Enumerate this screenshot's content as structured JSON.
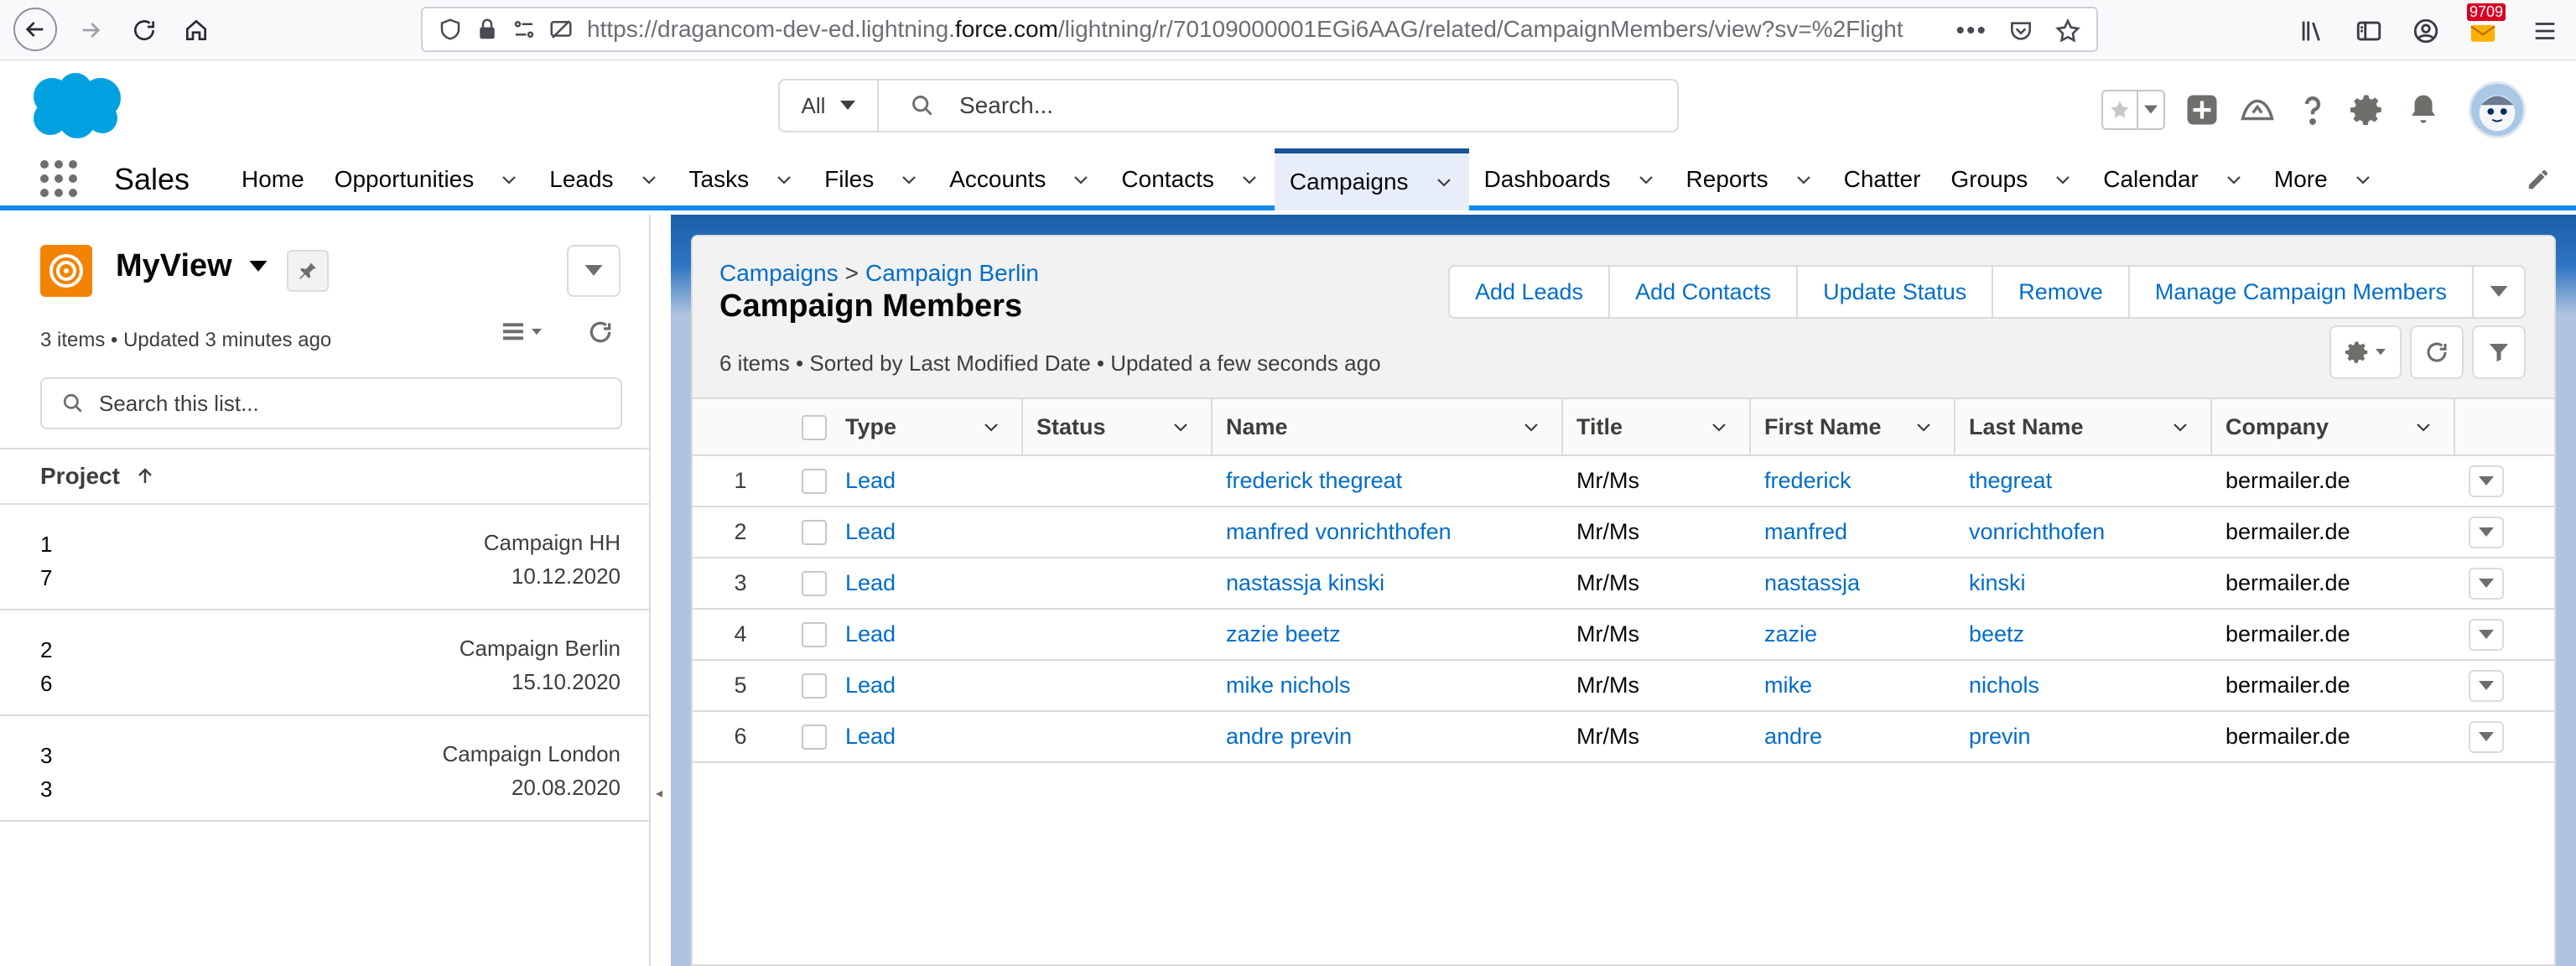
{
  "browser": {
    "url_prefix": "https://dragancom-dev-ed.lightning.",
    "url_domain": "force.com",
    "url_rest": "/lightning/r/70109000001EGi6AAG/related/CampaignMembers/view?sv=%2Flight",
    "mail_badge": "9709"
  },
  "header": {
    "scope_label": "All",
    "search_placeholder": "Search..."
  },
  "nav": {
    "app_name": "Sales",
    "items": [
      {
        "label": "Home",
        "dropdown": false
      },
      {
        "label": "Opportunities",
        "dropdown": true
      },
      {
        "label": "Leads",
        "dropdown": true
      },
      {
        "label": "Tasks",
        "dropdown": true
      },
      {
        "label": "Files",
        "dropdown": true
      },
      {
        "label": "Accounts",
        "dropdown": true
      },
      {
        "label": "Contacts",
        "dropdown": true
      },
      {
        "label": "Campaigns",
        "dropdown": true,
        "active": true
      },
      {
        "label": "Dashboards",
        "dropdown": true
      },
      {
        "label": "Reports",
        "dropdown": true
      },
      {
        "label": "Chatter",
        "dropdown": false
      },
      {
        "label": "Groups",
        "dropdown": true
      },
      {
        "label": "Calendar",
        "dropdown": true
      },
      {
        "label": "More",
        "dropdown": true
      }
    ]
  },
  "left_panel": {
    "title": "MyView",
    "meta": "3 items • Updated 3 minutes ago",
    "search_placeholder": "Search this list...",
    "column_header": "Project",
    "rows": [
      {
        "num": "1",
        "sub": "7",
        "name": "Campaign HH",
        "date": "10.12.2020"
      },
      {
        "num": "2",
        "sub": "6",
        "name": "Campaign Berlin",
        "date": "15.10.2020"
      },
      {
        "num": "3",
        "sub": "3",
        "name": "Campaign London",
        "date": "20.08.2020"
      }
    ]
  },
  "main": {
    "breadcrumb_parent": "Campaigns",
    "breadcrumb_sep": ">",
    "breadcrumb_current": "Campaign Berlin",
    "title": "Campaign Members",
    "meta": "6 items • Sorted by Last Modified Date • Updated a few seconds ago",
    "buttons": [
      "Add Leads",
      "Add Contacts",
      "Update Status",
      "Remove",
      "Manage Campaign Members"
    ],
    "columns": [
      "Type",
      "Status",
      "Name",
      "Title",
      "First Name",
      "Last Name",
      "Company"
    ],
    "rows": [
      {
        "num": "1",
        "type": "Lead",
        "status": "",
        "name": "frederick thegreat",
        "title": "Mr/Ms",
        "first": "frederick",
        "last": "thegreat",
        "company": "bermailer.de"
      },
      {
        "num": "2",
        "type": "Lead",
        "status": "",
        "name": "manfred vonrichthofen",
        "title": "Mr/Ms",
        "first": "manfred",
        "last": "vonrichthofen",
        "company": "bermailer.de"
      },
      {
        "num": "3",
        "type": "Lead",
        "status": "",
        "name": "nastassja kinski",
        "title": "Mr/Ms",
        "first": "nastassja",
        "last": "kinski",
        "company": "bermailer.de"
      },
      {
        "num": "4",
        "type": "Lead",
        "status": "",
        "name": "zazie beetz",
        "title": "Mr/Ms",
        "first": "zazie",
        "last": "beetz",
        "company": "bermailer.de"
      },
      {
        "num": "5",
        "type": "Lead",
        "status": "",
        "name": "mike nichols",
        "title": "Mr/Ms",
        "first": "mike",
        "last": "nichols",
        "company": "bermailer.de"
      },
      {
        "num": "6",
        "type": "Lead",
        "status": "",
        "name": "andre previn",
        "title": "Mr/Ms",
        "first": "andre",
        "last": "previn",
        "company": "bermailer.de"
      }
    ]
  },
  "colors": {
    "brand_blue": "#1589ee",
    "link_blue": "#006dcc",
    "campaign_icon": "#f38303"
  }
}
